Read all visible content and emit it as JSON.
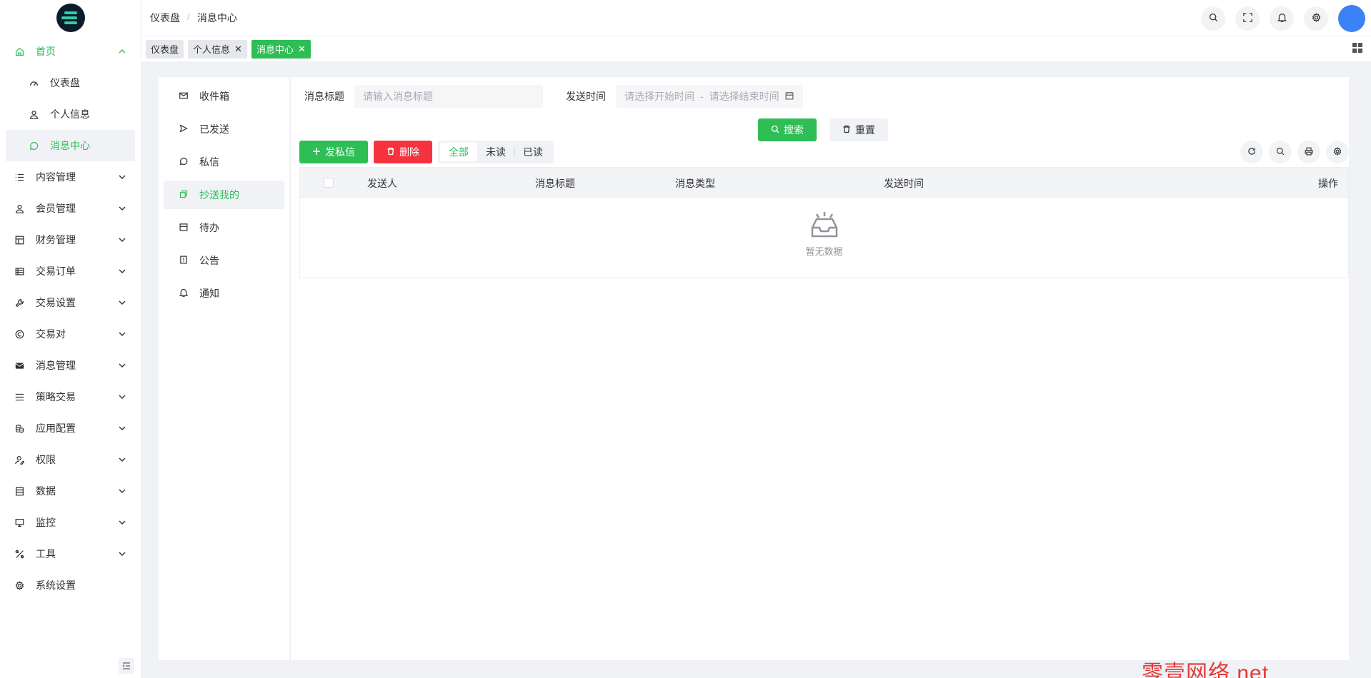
{
  "header": {
    "breadcrumb": [
      "仪表盘",
      "消息中心"
    ],
    "separator": "/"
  },
  "tags": [
    {
      "label": "仪表盘",
      "closable": false,
      "active": false
    },
    {
      "label": "个人信息",
      "closable": true,
      "active": false
    },
    {
      "label": "消息中心",
      "closable": true,
      "active": true
    }
  ],
  "sidebar": {
    "home": {
      "label": "首页"
    },
    "sub_items": [
      {
        "label": "仪表盘",
        "icon": "dashboard-icon"
      },
      {
        "label": "个人信息",
        "icon": "user-icon"
      },
      {
        "label": "消息中心",
        "icon": "chat-icon"
      }
    ],
    "items": [
      {
        "label": "内容管理",
        "icon": "list-icon"
      },
      {
        "label": "会员管理",
        "icon": "user-icon"
      },
      {
        "label": "财务管理",
        "icon": "layout-icon"
      },
      {
        "label": "交易订单",
        "icon": "table-icon"
      },
      {
        "label": "交易设置",
        "icon": "wrench-icon"
      },
      {
        "label": "交易对",
        "icon": "copyright-icon"
      },
      {
        "label": "消息管理",
        "icon": "message-icon"
      },
      {
        "label": "策略交易",
        "icon": "menu-icon"
      },
      {
        "label": "应用配置",
        "icon": "coins-icon"
      },
      {
        "label": "权限",
        "icon": "user-edit-icon"
      },
      {
        "label": "数据",
        "icon": "database-icon"
      },
      {
        "label": "监控",
        "icon": "monitor-icon"
      },
      {
        "label": "工具",
        "icon": "tools-icon"
      },
      {
        "label": "系统设置",
        "icon": "gear-icon"
      }
    ]
  },
  "message_nav": [
    {
      "label": "收件箱",
      "icon": "mail-icon"
    },
    {
      "label": "已发送",
      "icon": "send-icon"
    },
    {
      "label": "私信",
      "icon": "chat-icon"
    },
    {
      "label": "抄送我的",
      "icon": "copy-icon"
    },
    {
      "label": "待办",
      "icon": "calendar-icon"
    },
    {
      "label": "公告",
      "icon": "notice-icon"
    },
    {
      "label": "通知",
      "icon": "bell-icon"
    }
  ],
  "filters": {
    "title_label": "消息标题",
    "title_placeholder": "请输入消息标题",
    "time_label": "发送时间",
    "start_placeholder": "请选择开始时间",
    "range_sep": "-",
    "end_placeholder": "请选择结束时间",
    "search_label": "搜索",
    "reset_label": "重置"
  },
  "toolbar": {
    "compose_label": "发私信",
    "delete_label": "删除",
    "segments": [
      "全部",
      "未读",
      "已读"
    ],
    "active_segment": "全部"
  },
  "table": {
    "columns": [
      "发送人",
      "消息标题",
      "消息类型",
      "发送时间",
      "操作"
    ],
    "empty_text": "暂无数据"
  },
  "watermark": "零壹网络.net",
  "colors": {
    "accent": "#2fbd55",
    "danger": "#f5333f",
    "avatar": "#3b82f6"
  }
}
